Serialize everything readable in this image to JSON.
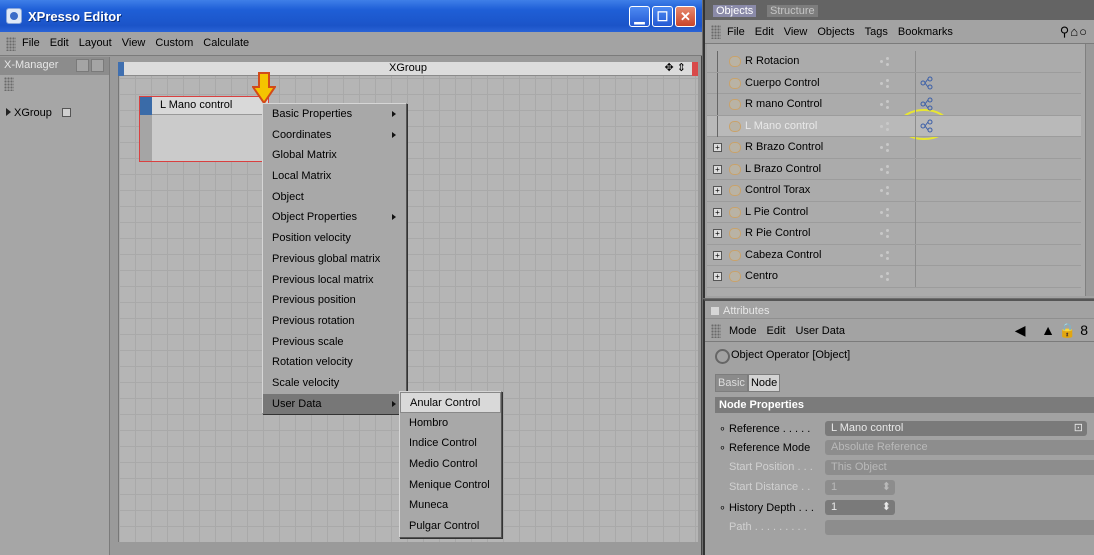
{
  "xpresso": {
    "title": "XPresso Editor",
    "menu": [
      "File",
      "Edit",
      "Layout",
      "View",
      "Custom",
      "Calculate"
    ],
    "xmanager_label": "X-Manager",
    "xmanager_item": "XGroup",
    "canvas_title": "XGroup",
    "node_title": "L Mano control",
    "context_menu": [
      {
        "label": "Basic Properties",
        "submenu": true
      },
      {
        "label": "Coordinates",
        "submenu": true
      },
      {
        "label": "Global Matrix",
        "submenu": false
      },
      {
        "label": "Local Matrix",
        "submenu": false
      },
      {
        "label": "Object",
        "submenu": false
      },
      {
        "label": "Object Properties",
        "submenu": true
      },
      {
        "label": "Position velocity",
        "submenu": false
      },
      {
        "label": "Previous global matrix",
        "submenu": false
      },
      {
        "label": "Previous local matrix",
        "submenu": false
      },
      {
        "label": "Previous position",
        "submenu": false
      },
      {
        "label": "Previous rotation",
        "submenu": false
      },
      {
        "label": "Previous scale",
        "submenu": false
      },
      {
        "label": "Rotation velocity",
        "submenu": false
      },
      {
        "label": "Scale velocity",
        "submenu": false
      },
      {
        "label": "User Data",
        "submenu": true
      }
    ],
    "user_data_submenu": [
      "Anular Control",
      "Hombro",
      "Indice Control",
      "Medio Control",
      "Menique Control",
      "Muneca",
      "Pulgar Control"
    ]
  },
  "objects": {
    "tabs": [
      "Objects",
      "Structure"
    ],
    "menu": [
      "File",
      "Edit",
      "View",
      "Objects",
      "Tags",
      "Bookmarks"
    ],
    "rows": [
      {
        "name": "R Rotacion",
        "expandable": false,
        "tag": false
      },
      {
        "name": "Cuerpo Control",
        "expandable": false,
        "tag": true
      },
      {
        "name": "R mano Control",
        "expandable": false,
        "tag": true
      },
      {
        "name": "L Mano control",
        "expandable": false,
        "tag": true,
        "selected": true
      },
      {
        "name": "R Brazo Control",
        "expandable": true,
        "tag": false
      },
      {
        "name": "L Brazo Control",
        "expandable": true,
        "tag": false
      },
      {
        "name": "Control Torax",
        "expandable": true,
        "tag": false
      },
      {
        "name": "L Pie Control",
        "expandable": true,
        "tag": false
      },
      {
        "name": "R Pie Control",
        "expandable": true,
        "tag": false
      },
      {
        "name": "Cabeza Control",
        "expandable": true,
        "tag": false
      },
      {
        "name": "Centro",
        "expandable": true,
        "tag": false
      }
    ]
  },
  "attributes": {
    "tab_label": "Attributes",
    "menu": [
      "Mode",
      "Edit",
      "User Data"
    ],
    "object_title": "Object Operator [Object]",
    "tabs": [
      "Basic",
      "Node"
    ],
    "section": "Node Properties",
    "reference_label": "Reference",
    "reference_value": "L Mano control",
    "ref_mode_label": "Reference Mode",
    "ref_mode_value": "Absolute Reference",
    "start_position_label": "Start Position",
    "start_position_value": "This Object",
    "start_distance_label": "Start Distance",
    "start_distance_value": "1",
    "history_depth_label": "History Depth",
    "history_depth_value": "1",
    "path_label": "Path"
  },
  "colors": {
    "titlebar": "#1f5fd7",
    "node_border": "#d94040",
    "highlight_ellipse": "#e8e630",
    "arrow": "#f5c400"
  }
}
